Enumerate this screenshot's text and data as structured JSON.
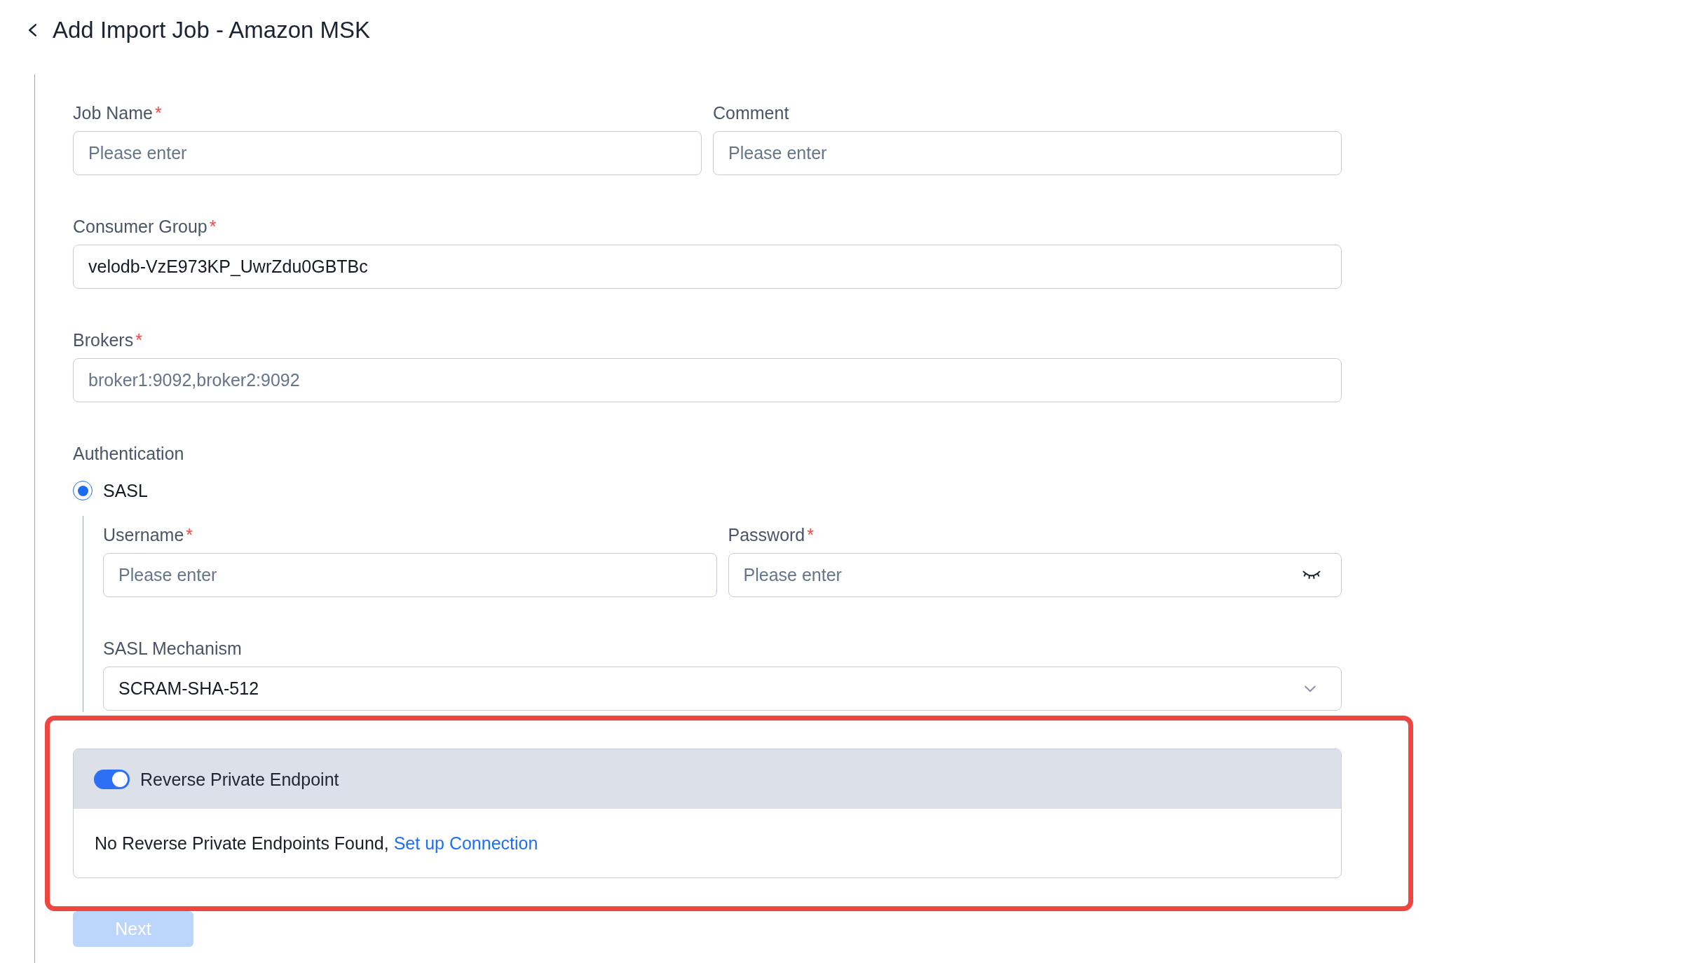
{
  "header": {
    "title": "Add Import Job - Amazon MSK"
  },
  "form": {
    "rows": [
      {
        "fields": [
          {
            "kind": "text",
            "label": "Job Name",
            "required_mark": "*",
            "placeholder": "Please enter"
          },
          {
            "kind": "text",
            "label": "Comment",
            "placeholder": "Please enter"
          }
        ]
      },
      {
        "fields": [
          {
            "kind": "text",
            "label": "Consumer Group",
            "required_mark": "*",
            "value": "velodb-VzE973KP_UwrZdu0GBTBc"
          }
        ]
      },
      {
        "fields": [
          {
            "kind": "text",
            "label": "Brokers",
            "required_mark": "*",
            "placeholder": "broker1:9092,broker2:9092"
          }
        ]
      }
    ],
    "authentication": {
      "label": "Authentication",
      "options": [
        {
          "label": "SASL",
          "selected": true
        }
      ],
      "sasl_rows": [
        {
          "fields": [
            {
              "kind": "text",
              "label": "Username",
              "required_mark": "*",
              "placeholder": "Please enter"
            },
            {
              "kind": "password",
              "label": "Password",
              "required_mark": "*",
              "placeholder": "Please enter"
            }
          ]
        },
        {
          "fields": [
            {
              "kind": "select",
              "label": "SASL Mechanism",
              "value": "SCRAM-SHA-512"
            }
          ]
        }
      ]
    },
    "reverse_private_endpoint": {
      "highlighted": true,
      "label": "Reverse Private Endpoint",
      "on": true,
      "message": "No Reverse Private Endpoints Found,",
      "link": "Set up Connection"
    }
  },
  "next_button": {
    "label": "Next",
    "disabled": true
  }
}
